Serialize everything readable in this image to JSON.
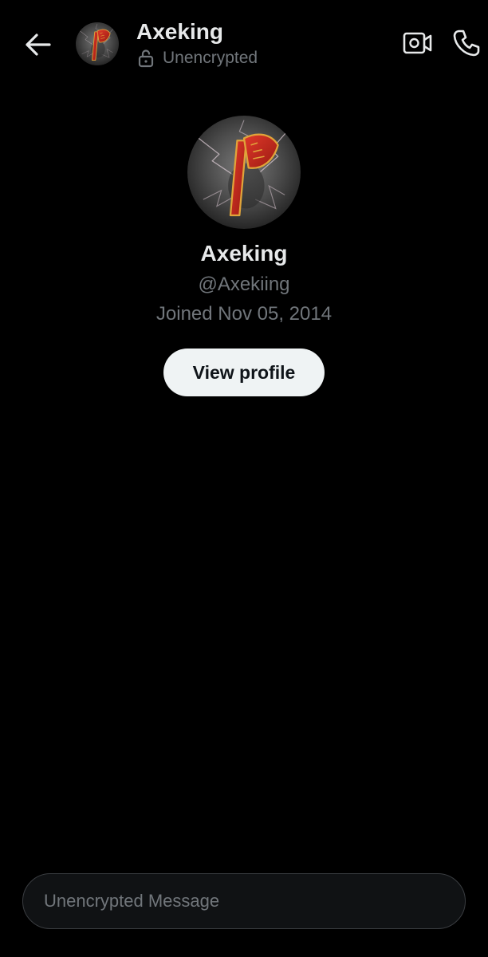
{
  "header": {
    "name": "Axeking",
    "status": "Unencrypted",
    "avatar_icon": "axe-logo-avatar",
    "back_icon": "arrow-left-icon",
    "status_icon": "unlock-icon",
    "video_icon": "video-call-icon",
    "call_icon": "phone-icon"
  },
  "profile": {
    "name": "Axeking",
    "handle": "@Axekiing",
    "joined": "Joined Nov 05, 2014",
    "view_profile_label": "View profile"
  },
  "composer": {
    "placeholder": "Unencrypted Message",
    "value": ""
  },
  "colors": {
    "background": "#000000",
    "primary_text": "#e7e9ea",
    "secondary_text": "#71767b",
    "button_bg": "#eff3f4",
    "button_text": "#0f1419",
    "axe_red": "#c0281c",
    "axe_gold": "#e0a43a"
  }
}
